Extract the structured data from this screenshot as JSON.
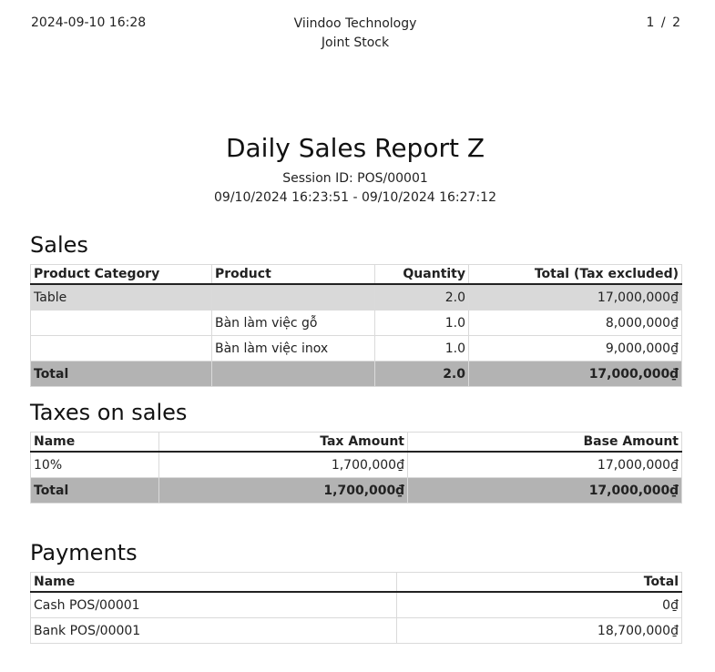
{
  "header": {
    "datetime": "2024-09-10 16:28",
    "company": "Viindoo Technology Joint Stock",
    "page_current": "1",
    "page_sep": "/",
    "page_total": "2"
  },
  "report": {
    "title": "Daily Sales Report Z",
    "session": "Session ID: POS/00001",
    "period": "09/10/2024 16:23:51 - 09/10/2024 16:27:12"
  },
  "sales": {
    "title": "Sales",
    "columns": [
      "Product Category",
      "Product",
      "Quantity",
      "Total (Tax excluded)"
    ],
    "category_row": {
      "category": "Table",
      "product": "",
      "quantity": "2.0",
      "total": "17,000,000₫"
    },
    "rows": [
      {
        "category": "",
        "product": "Bàn làm việc gỗ",
        "quantity": "1.0",
        "total": "8,000,000₫"
      },
      {
        "category": "",
        "product": "Bàn làm việc inox",
        "quantity": "1.0",
        "total": "9,000,000₫"
      }
    ],
    "total_row": {
      "label": "Total",
      "product": "",
      "quantity": "2.0",
      "total": "17,000,000₫"
    }
  },
  "taxes": {
    "title": "Taxes on sales",
    "columns": [
      "Name",
      "Tax Amount",
      "Base Amount"
    ],
    "rows": [
      {
        "name": "10%",
        "tax_amount": "1,700,000₫",
        "base_amount": "17,000,000₫"
      }
    ],
    "total_row": {
      "label": "Total",
      "tax_amount": "1,700,000₫",
      "base_amount": "17,000,000₫"
    }
  },
  "payments": {
    "title": "Payments",
    "columns": [
      "Name",
      "Total"
    ],
    "rows": [
      {
        "name": "Cash POS/00001",
        "total": "0₫"
      },
      {
        "name": "Bank POS/00001",
        "total": "18,700,000₫"
      }
    ]
  }
}
